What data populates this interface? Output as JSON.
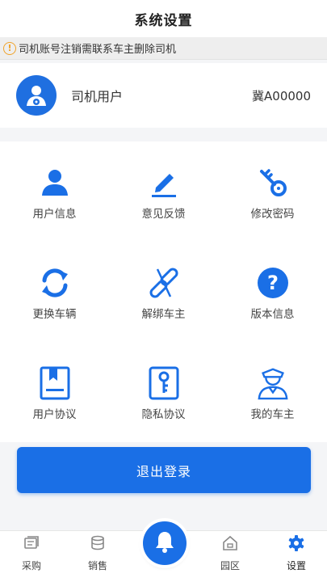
{
  "header": {
    "title": "系统设置"
  },
  "notice": {
    "text": "司机账号注销需联系车主删除司机"
  },
  "profile": {
    "name": "司机用户",
    "plate": "冀A00000"
  },
  "menu": [
    {
      "label": "用户信息",
      "icon": "user-icon"
    },
    {
      "label": "意见反馈",
      "icon": "pencil-icon"
    },
    {
      "label": "修改密码",
      "icon": "key-icon"
    },
    {
      "label": "更换车辆",
      "icon": "refresh-icon"
    },
    {
      "label": "解绑车主",
      "icon": "unlink-icon"
    },
    {
      "label": "版本信息",
      "icon": "question-icon"
    },
    {
      "label": "用户协议",
      "icon": "bookmark-doc-icon"
    },
    {
      "label": "隐私协议",
      "icon": "key-doc-icon"
    },
    {
      "label": "我的车主",
      "icon": "chauffeur-icon"
    }
  ],
  "logout": {
    "label": "退出登录"
  },
  "tabs": [
    {
      "label": "采购",
      "icon": "purchase-icon"
    },
    {
      "label": "销售",
      "icon": "sales-icon"
    },
    {
      "label": "园区",
      "icon": "park-icon"
    },
    {
      "label": "设置",
      "icon": "settings-icon",
      "active": true
    }
  ],
  "colors": {
    "primary": "#1a6fe6",
    "warning": "#f0a32a",
    "background": "#f4f5f7"
  }
}
